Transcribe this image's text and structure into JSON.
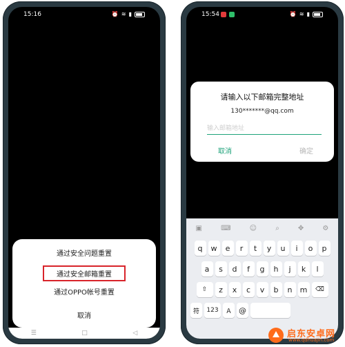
{
  "left_phone": {
    "status_time": "15:16",
    "sheet_options": [
      "通过安全问题重置",
      "通过安全邮箱重置",
      "通过OPPO帐号重置"
    ],
    "cancel_label": "取消"
  },
  "right_phone": {
    "status_time": "15:54",
    "dialog": {
      "title": "请输入以下邮箱完整地址",
      "masked_email": "130*******@qq.com",
      "input_placeholder": "输入邮箱地址",
      "cancel_label": "取消",
      "confirm_label": "确定"
    },
    "keyboard": {
      "row1": [
        "q",
        "w",
        "e",
        "r",
        "t",
        "y",
        "u",
        "i",
        "o",
        "p"
      ],
      "row2": [
        "a",
        "s",
        "d",
        "f",
        "g",
        "h",
        "j",
        "k",
        "l"
      ],
      "row3": [
        "z",
        "x",
        "c",
        "v",
        "b",
        "n",
        "m"
      ],
      "bottom": {
        "symbols": "符",
        "num": "123",
        "at": "@"
      }
    }
  },
  "watermark": {
    "text": "启东安卓网",
    "url": "www.qdhuajin.com"
  },
  "colors": {
    "accent_green": "#1ea27a",
    "highlight_red": "#d8232a",
    "watermark_orange": "#ff6b1a"
  }
}
